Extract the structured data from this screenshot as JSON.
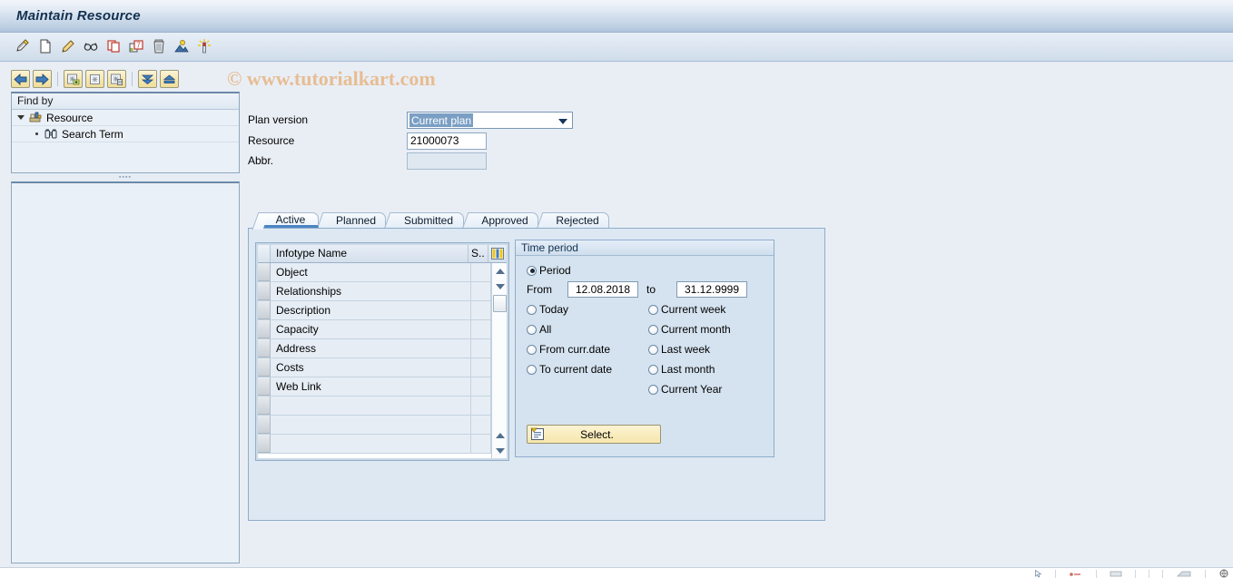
{
  "window": {
    "title": "Maintain Resource"
  },
  "watermark": "© www.tutorialkart.com",
  "app_toolbar": {
    "buttons": [
      {
        "name": "display-change-icon",
        "tip": "Display <-> Change"
      },
      {
        "name": "create-icon",
        "tip": "Create"
      },
      {
        "name": "edit-icon",
        "tip": "Change"
      },
      {
        "name": "display-icon",
        "tip": "Display"
      },
      {
        "name": "copy-icon",
        "tip": "Copy"
      },
      {
        "name": "delimit-icon",
        "tip": "Delimit"
      },
      {
        "name": "delete-icon",
        "tip": "Delete"
      },
      {
        "name": "graphics-icon",
        "tip": "Graphics"
      },
      {
        "name": "report-icon",
        "tip": "Report"
      }
    ]
  },
  "sidebar": {
    "nav_buttons": [
      {
        "name": "back-icon",
        "tip": "Back"
      },
      {
        "name": "forward-icon",
        "tip": "Forward"
      },
      {
        "name": "add-search-icon",
        "tip": "Add Search Node"
      },
      {
        "name": "search-node-icon",
        "tip": "Search Node"
      },
      {
        "name": "delete-search-icon",
        "tip": "Delete Search Node"
      },
      {
        "name": "collapse-all-icon",
        "tip": "Collapse"
      },
      {
        "name": "expand-all-icon",
        "tip": "Expand"
      }
    ],
    "find_by_header": "Find by",
    "tree": [
      {
        "label": "Resource",
        "icon": "resource-icon",
        "expanded": true,
        "level": 0
      },
      {
        "label": "Search Term",
        "icon": "binoculars-icon",
        "expanded": false,
        "level": 1
      }
    ]
  },
  "form": {
    "plan_version": {
      "label": "Plan version",
      "value": "Current plan",
      "options": [
        "Current plan"
      ]
    },
    "resource": {
      "label": "Resource",
      "value": "21000073",
      "placeholder": ""
    },
    "abbr": {
      "label": "Abbr.",
      "value": "",
      "placeholder": ""
    }
  },
  "tabs": [
    {
      "label": "Active",
      "active": true
    },
    {
      "label": "Planned",
      "active": false
    },
    {
      "label": "Submitted",
      "active": false
    },
    {
      "label": "Approved",
      "active": false
    },
    {
      "label": "Rejected",
      "active": false
    }
  ],
  "infotype_table": {
    "columns": [
      "",
      "Infotype Name",
      "S..",
      ""
    ],
    "config_icon": "table-settings-icon",
    "rows": [
      {
        "name": "Object",
        "s": ""
      },
      {
        "name": "Relationships",
        "s": ""
      },
      {
        "name": "Description",
        "s": ""
      },
      {
        "name": "Capacity",
        "s": ""
      },
      {
        "name": "Address",
        "s": ""
      },
      {
        "name": "Costs",
        "s": ""
      },
      {
        "name": "Web Link",
        "s": ""
      },
      {
        "name": "",
        "s": ""
      },
      {
        "name": "",
        "s": ""
      },
      {
        "name": "",
        "s": ""
      }
    ]
  },
  "time_period": {
    "title": "Time period",
    "period": {
      "label": "Period",
      "selected": true,
      "from_label": "From",
      "from_value": "12.08.2018",
      "to_label": "to",
      "to_value": "31.12.9999"
    },
    "options_left": [
      {
        "label": "Today",
        "selected": false
      },
      {
        "label": "All",
        "selected": false
      },
      {
        "label": "From curr.date",
        "selected": false
      },
      {
        "label": "To current date",
        "selected": false
      }
    ],
    "options_right": [
      {
        "label": "Current week",
        "selected": false
      },
      {
        "label": "Current month",
        "selected": false
      },
      {
        "label": "Last week",
        "selected": false
      },
      {
        "label": "Last month",
        "selected": false
      },
      {
        "label": "Current Year",
        "selected": false
      }
    ],
    "select_button": {
      "label": "Select.",
      "icon": "selection-icon"
    }
  },
  "colors": {
    "title_bar_text": "#12314f",
    "accent_tab_underline": "#4a85c4",
    "field_border": "#8fa8c0",
    "panel_bg": "#dde8f3",
    "button_yellow": "#f6e7ac",
    "selection_blue": "#7b9fc4",
    "watermark": "#e7b583"
  }
}
